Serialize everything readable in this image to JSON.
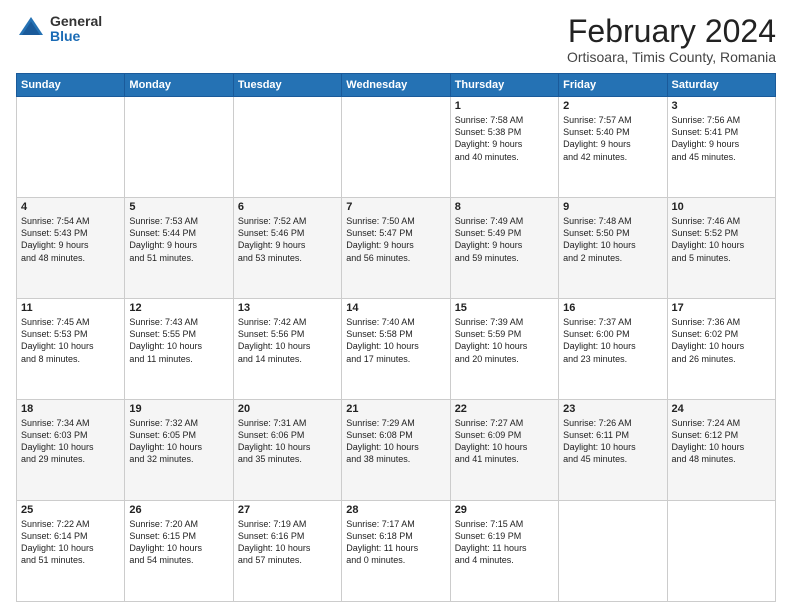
{
  "logo": {
    "general": "General",
    "blue": "Blue"
  },
  "header": {
    "month": "February 2024",
    "location": "Ortisoara, Timis County, Romania"
  },
  "weekdays": [
    "Sunday",
    "Monday",
    "Tuesday",
    "Wednesday",
    "Thursday",
    "Friday",
    "Saturday"
  ],
  "weeks": [
    [
      {
        "day": "",
        "content": ""
      },
      {
        "day": "",
        "content": ""
      },
      {
        "day": "",
        "content": ""
      },
      {
        "day": "",
        "content": ""
      },
      {
        "day": "1",
        "content": "Sunrise: 7:58 AM\nSunset: 5:38 PM\nDaylight: 9 hours\nand 40 minutes."
      },
      {
        "day": "2",
        "content": "Sunrise: 7:57 AM\nSunset: 5:40 PM\nDaylight: 9 hours\nand 42 minutes."
      },
      {
        "day": "3",
        "content": "Sunrise: 7:56 AM\nSunset: 5:41 PM\nDaylight: 9 hours\nand 45 minutes."
      }
    ],
    [
      {
        "day": "4",
        "content": "Sunrise: 7:54 AM\nSunset: 5:43 PM\nDaylight: 9 hours\nand 48 minutes."
      },
      {
        "day": "5",
        "content": "Sunrise: 7:53 AM\nSunset: 5:44 PM\nDaylight: 9 hours\nand 51 minutes."
      },
      {
        "day": "6",
        "content": "Sunrise: 7:52 AM\nSunset: 5:46 PM\nDaylight: 9 hours\nand 53 minutes."
      },
      {
        "day": "7",
        "content": "Sunrise: 7:50 AM\nSunset: 5:47 PM\nDaylight: 9 hours\nand 56 minutes."
      },
      {
        "day": "8",
        "content": "Sunrise: 7:49 AM\nSunset: 5:49 PM\nDaylight: 9 hours\nand 59 minutes."
      },
      {
        "day": "9",
        "content": "Sunrise: 7:48 AM\nSunset: 5:50 PM\nDaylight: 10 hours\nand 2 minutes."
      },
      {
        "day": "10",
        "content": "Sunrise: 7:46 AM\nSunset: 5:52 PM\nDaylight: 10 hours\nand 5 minutes."
      }
    ],
    [
      {
        "day": "11",
        "content": "Sunrise: 7:45 AM\nSunset: 5:53 PM\nDaylight: 10 hours\nand 8 minutes."
      },
      {
        "day": "12",
        "content": "Sunrise: 7:43 AM\nSunset: 5:55 PM\nDaylight: 10 hours\nand 11 minutes."
      },
      {
        "day": "13",
        "content": "Sunrise: 7:42 AM\nSunset: 5:56 PM\nDaylight: 10 hours\nand 14 minutes."
      },
      {
        "day": "14",
        "content": "Sunrise: 7:40 AM\nSunset: 5:58 PM\nDaylight: 10 hours\nand 17 minutes."
      },
      {
        "day": "15",
        "content": "Sunrise: 7:39 AM\nSunset: 5:59 PM\nDaylight: 10 hours\nand 20 minutes."
      },
      {
        "day": "16",
        "content": "Sunrise: 7:37 AM\nSunset: 6:00 PM\nDaylight: 10 hours\nand 23 minutes."
      },
      {
        "day": "17",
        "content": "Sunrise: 7:36 AM\nSunset: 6:02 PM\nDaylight: 10 hours\nand 26 minutes."
      }
    ],
    [
      {
        "day": "18",
        "content": "Sunrise: 7:34 AM\nSunset: 6:03 PM\nDaylight: 10 hours\nand 29 minutes."
      },
      {
        "day": "19",
        "content": "Sunrise: 7:32 AM\nSunset: 6:05 PM\nDaylight: 10 hours\nand 32 minutes."
      },
      {
        "day": "20",
        "content": "Sunrise: 7:31 AM\nSunset: 6:06 PM\nDaylight: 10 hours\nand 35 minutes."
      },
      {
        "day": "21",
        "content": "Sunrise: 7:29 AM\nSunset: 6:08 PM\nDaylight: 10 hours\nand 38 minutes."
      },
      {
        "day": "22",
        "content": "Sunrise: 7:27 AM\nSunset: 6:09 PM\nDaylight: 10 hours\nand 41 minutes."
      },
      {
        "day": "23",
        "content": "Sunrise: 7:26 AM\nSunset: 6:11 PM\nDaylight: 10 hours\nand 45 minutes."
      },
      {
        "day": "24",
        "content": "Sunrise: 7:24 AM\nSunset: 6:12 PM\nDaylight: 10 hours\nand 48 minutes."
      }
    ],
    [
      {
        "day": "25",
        "content": "Sunrise: 7:22 AM\nSunset: 6:14 PM\nDaylight: 10 hours\nand 51 minutes."
      },
      {
        "day": "26",
        "content": "Sunrise: 7:20 AM\nSunset: 6:15 PM\nDaylight: 10 hours\nand 54 minutes."
      },
      {
        "day": "27",
        "content": "Sunrise: 7:19 AM\nSunset: 6:16 PM\nDaylight: 10 hours\nand 57 minutes."
      },
      {
        "day": "28",
        "content": "Sunrise: 7:17 AM\nSunset: 6:18 PM\nDaylight: 11 hours\nand 0 minutes."
      },
      {
        "day": "29",
        "content": "Sunrise: 7:15 AM\nSunset: 6:19 PM\nDaylight: 11 hours\nand 4 minutes."
      },
      {
        "day": "",
        "content": ""
      },
      {
        "day": "",
        "content": ""
      }
    ]
  ]
}
